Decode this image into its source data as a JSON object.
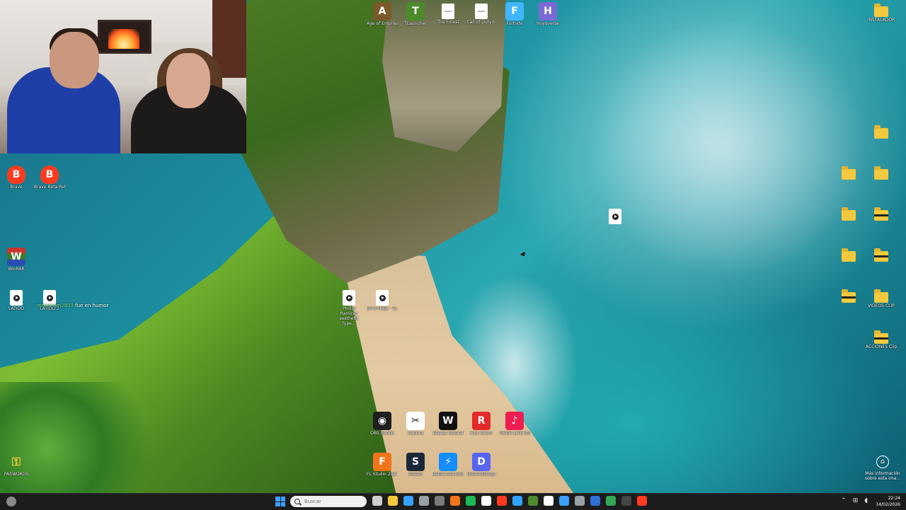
{
  "desktop": {
    "icons_top": [
      {
        "label": "Age of Empires II",
        "name": "age-of-empires-icon",
        "color": "#7a5a2a",
        "glyph": "A"
      },
      {
        "label": "TLauncher",
        "name": "tlauncher-icon",
        "color": "#4c8a2c",
        "glyph": "T"
      },
      {
        "label": "The Forest",
        "name": "the-forest-icon",
        "color": "#ffffff",
        "glyph": ""
      },
      {
        "label": "Call of Duty®",
        "name": "call-of-duty-icon",
        "color": "#ffffff",
        "glyph": ""
      },
      {
        "label": "Fortnite",
        "name": "fortnite-icon",
        "color": "#3fb6ff",
        "glyph": "F"
      },
      {
        "label": "Hoyoverse",
        "name": "hoyoverse-icon",
        "color": "#7a6ad6",
        "glyph": "H"
      }
    ],
    "icon_instalador": {
      "label": "INSTALADOR"
    },
    "icons_left": [
      {
        "label": "Brave",
        "name": "brave-icon",
        "color": "#ff3b1f",
        "glyph": "B"
      },
      {
        "label": "Brave Beta Rebrand",
        "name": "brave-beta-icon",
        "color": "#ff3b1f",
        "glyph": "B"
      },
      {
        "label": "WinRAR",
        "name": "winrar-icon",
        "color": "#8a2a7a",
        "glyph": "W"
      },
      {
        "label": "LATIDO",
        "name": "latido-file-icon"
      },
      {
        "label": "LATIDO 2",
        "name": "latido-2-file-icon"
      }
    ],
    "chat_message": {
      "user": "mmmmm2803",
      "text": "fue en humor"
    },
    "icons_beach": [
      {
        "label": "Phillip Ramirez aesthetic type...",
        "name": "audio-file-icon-1"
      },
      {
        "label": "00 0 FREE - Vi...",
        "name": "audio-file-icon-2"
      }
    ],
    "icons_bottom_row1": [
      {
        "label": "OBS Studio",
        "name": "obs-studio-icon",
        "color": "#1e1e1e",
        "glyph": "◉"
      },
      {
        "label": "CapCut",
        "name": "capcut-icon",
        "color": "#ffffff",
        "glyph": "✂"
      },
      {
        "label": "Waves Central",
        "name": "waves-central-icon",
        "color": "#111111",
        "glyph": "W"
      },
      {
        "label": "Riot Client",
        "name": "riot-client-icon",
        "color": "#e22a2a",
        "glyph": "R"
      },
      {
        "label": "TikTok LIVE Studio",
        "name": "tiktok-live-icon",
        "color": "#ee1d52",
        "glyph": "♪"
      }
    ],
    "icons_bottom_row2": [
      {
        "label": "FL Studio 2024",
        "name": "fl-studio-icon",
        "color": "#f2751a",
        "glyph": "F"
      },
      {
        "label": "Steam",
        "name": "steam-icon",
        "color": "#1b2838",
        "glyph": "S"
      },
      {
        "label": "Battle.net tools",
        "name": "battlenet-icon",
        "color": "#148eff",
        "glyph": "⚡"
      },
      {
        "label": "DiscordSetup",
        "name": "discord-icon",
        "color": "#5865f2",
        "glyph": "D"
      }
    ],
    "icon_paswords": {
      "label": "PASWORDS"
    },
    "icons_right": [
      {
        "label": "",
        "name": "folder-icon-1",
        "type": "folder"
      },
      {
        "label": "",
        "name": "folder-icon-2",
        "type": "folder"
      },
      {
        "label": "",
        "name": "folder-icon-3",
        "type": "folder"
      },
      {
        "label": "",
        "name": "folder-icon-4",
        "type": "folder"
      },
      {
        "label": "",
        "name": "folder-icon-5",
        "type": "folder-dark"
      },
      {
        "label": "",
        "name": "folder-icon-6",
        "type": "folder"
      },
      {
        "label": "",
        "name": "folder-icon-7",
        "type": "folder-dark"
      },
      {
        "label": "",
        "name": "folder-icon-8",
        "type": "folder-dark"
      },
      {
        "label": "VIDEOS CLIP",
        "name": "folder-icon-9",
        "type": "folder"
      },
      {
        "label": "ACCIONES Clips",
        "name": "folder-icon-10",
        "type": "folder-dark"
      }
    ],
    "info_corner": {
      "text": "Más información sobre esta ima..."
    }
  },
  "taskbar": {
    "search_placeholder": "Buscar",
    "apps": [
      {
        "name": "task-view-icon",
        "color": "#cfcfcf"
      },
      {
        "name": "file-explorer-icon",
        "color": "#f4c93d"
      },
      {
        "name": "ms-store-icon",
        "color": "#3aa0ff"
      },
      {
        "name": "settings-icon",
        "color": "#9aa0a6"
      },
      {
        "name": "calculator-icon",
        "color": "#7a7a7a"
      },
      {
        "name": "fl-studio-taskbar-icon",
        "color": "#f2751a"
      },
      {
        "name": "spotify-icon",
        "color": "#1db954"
      },
      {
        "name": "notes-icon",
        "color": "#ffffff"
      },
      {
        "name": "brave-taskbar-icon",
        "color": "#ff3b1f"
      },
      {
        "name": "photoshop-icon",
        "color": "#2fa3ff"
      },
      {
        "name": "app-green-icon",
        "color": "#4c8a2c"
      },
      {
        "name": "capcut-taskbar-icon",
        "color": "#ffffff"
      },
      {
        "name": "mail-icon",
        "color": "#3aa0ff"
      },
      {
        "name": "network-app-icon",
        "color": "#9aa0a6"
      },
      {
        "name": "app-blue-icon",
        "color": "#2f6fd6"
      },
      {
        "name": "chrome-icon",
        "color": "#34a853"
      },
      {
        "name": "obs-taskbar-icon",
        "color": "#444444"
      },
      {
        "name": "brave-beta-taskbar-icon",
        "color": "#ff3b1f"
      }
    ],
    "time": "22:24",
    "date": "14/02/2026"
  }
}
